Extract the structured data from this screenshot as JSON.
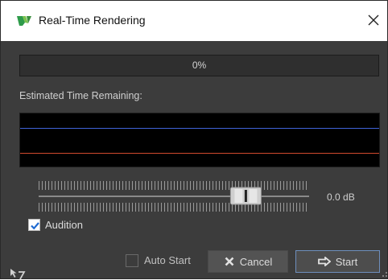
{
  "window": {
    "title": "Real-Time Rendering"
  },
  "progress": {
    "text": "0%",
    "fraction": 0.0
  },
  "estimate": {
    "label": "Estimated Time Remaining:"
  },
  "scope": {
    "line_colors": {
      "top": "#3f63d8",
      "bottom": "#d24a2e"
    }
  },
  "gain": {
    "readout": "0.0 dB",
    "position": 0.8
  },
  "audition": {
    "label": "Audition",
    "checked": true
  },
  "auto_start": {
    "label": "Auto Start",
    "checked": false
  },
  "buttons": {
    "cancel": "Cancel",
    "start": "Start"
  },
  "icons": {
    "app": "wavelab-logo-icon",
    "close": "close-icon",
    "cancel": "x-icon",
    "start": "start-arrow-icon",
    "corner": "cursor-icon"
  },
  "colors": {
    "background": "#3c3c3c",
    "titlebar": "#ffffff",
    "accent": "#6e8fbd",
    "check": "#1f6ad1"
  }
}
